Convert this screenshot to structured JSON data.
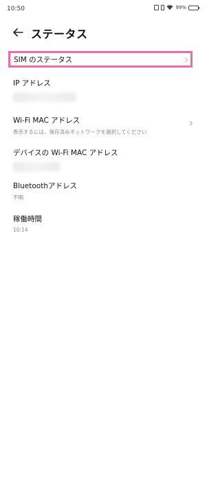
{
  "status_bar": {
    "time": "10:50",
    "battery": "99%",
    "battery_level": 0.99,
    "icons": [
      "nfc-icon",
      "vibrate-icon",
      "wifi-icon",
      "battery-icon"
    ]
  },
  "header": {
    "title": "ステータス",
    "back_icon": "arrow-left-icon"
  },
  "rows": {
    "sim": {
      "title": "SIM のステータス",
      "highlight_color": "#f06aa6"
    },
    "ip": {
      "title": "IP アドレス"
    },
    "wifi_mac": {
      "title": "Wi-Fi MAC アドレス",
      "subtitle": "表示するには、保存済みネットワークを選択してください"
    },
    "device_wifi_mac": {
      "title": "デバイスの Wi-Fi MAC アドレス"
    },
    "bluetooth": {
      "title": "Bluetoothアドレス",
      "value": "不明"
    },
    "uptime": {
      "title": "稼働時間",
      "value": "10:14"
    }
  }
}
